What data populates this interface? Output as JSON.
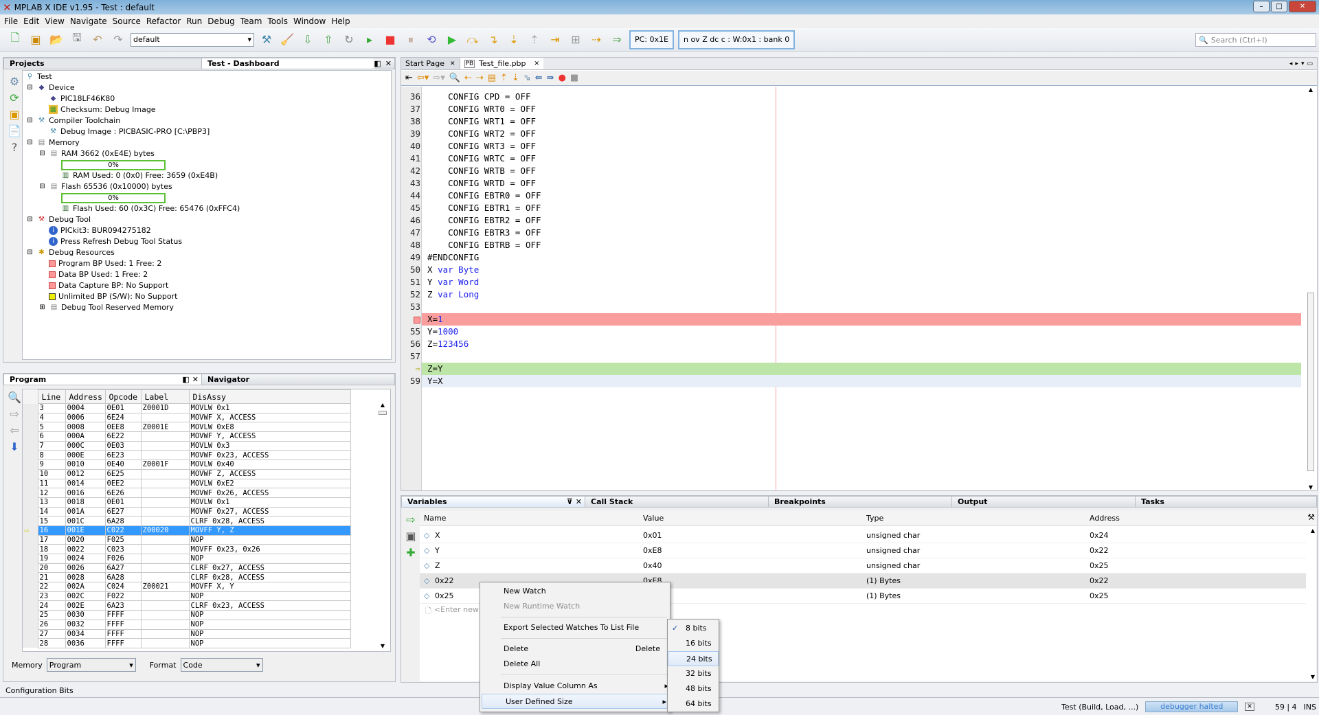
{
  "window": {
    "title": "MPLAB X IDE v1.95 - Test : default"
  },
  "menu": [
    "File",
    "Edit",
    "View",
    "Navigate",
    "Source",
    "Refactor",
    "Run",
    "Debug",
    "Team",
    "Tools",
    "Window",
    "Help"
  ],
  "toolbar": {
    "config_select": "default",
    "pc": "PC: 0x1E",
    "status_reg": "n ov Z dc c  : W:0x1 : bank 0",
    "search_placeholder": "Search (Ctrl+I)"
  },
  "projects": {
    "tab_projects": "Projects",
    "tab_dashboard": "Test - Dashboard",
    "tree": {
      "root": "Test",
      "device": "Device",
      "device_name": "PIC18LF46K80",
      "checksum": "Checksum: Debug Image",
      "compiler": "Compiler Toolchain",
      "debug_image": "Debug Image : PICBASIC-PRO [C:\\PBP3]",
      "memory": "Memory",
      "ram": "RAM 3662 (0xE4E) bytes",
      "ram_pct": "0%",
      "ram_used": "RAM Used: 0 (0x0) Free: 3659 (0xE4B)",
      "flash": "Flash 65536 (0x10000) bytes",
      "flash_pct": "0%",
      "flash_used": "Flash Used: 60 (0x3C) Free: 65476 (0xFFC4)",
      "debug_tool": "Debug Tool",
      "pickit": "PICkit3: BUR094275182",
      "refresh": "Press Refresh Debug Tool Status",
      "debug_resources": "Debug Resources",
      "prog_bp": "Program BP Used: 1  Free: 2",
      "data_bp": "Data BP Used: 1  Free: 2",
      "data_capture": "Data Capture BP: No Support",
      "unlimited_bp": "Unlimited BP (S/W): No Support",
      "reserved": "Debug Tool Reserved Memory"
    },
    "ram_fraction": 0,
    "flash_fraction": 0
  },
  "program": {
    "tab_program": "Program",
    "tab_navigator": "Navigator",
    "columns": [
      "Line",
      "Address",
      "Opcode",
      "Label",
      "DisAssy"
    ],
    "rows": [
      [
        "3",
        "0004",
        "0E01",
        "Z0001D",
        "MOVLW 0x1"
      ],
      [
        "4",
        "0006",
        "6E24",
        "",
        "MOVWF X, ACCESS"
      ],
      [
        "5",
        "0008",
        "0EE8",
        "Z0001E",
        "MOVLW 0xE8"
      ],
      [
        "6",
        "000A",
        "6E22",
        "",
        "MOVWF Y, ACCESS"
      ],
      [
        "7",
        "000C",
        "0E03",
        "",
        "MOVLW 0x3"
      ],
      [
        "8",
        "000E",
        "6E23",
        "",
        "MOVWF 0x23, ACCESS"
      ],
      [
        "9",
        "0010",
        "0E40",
        "Z0001F",
        "MOVLW 0x40"
      ],
      [
        "10",
        "0012",
        "6E25",
        "",
        "MOVWF Z, ACCESS"
      ],
      [
        "11",
        "0014",
        "0EE2",
        "",
        "MOVLW 0xE2"
      ],
      [
        "12",
        "0016",
        "6E26",
        "",
        "MOVWF 0x26, ACCESS"
      ],
      [
        "13",
        "0018",
        "0E01",
        "",
        "MOVLW 0x1"
      ],
      [
        "14",
        "001A",
        "6E27",
        "",
        "MOVWF 0x27, ACCESS"
      ],
      [
        "15",
        "001C",
        "6A28",
        "",
        "CLRF 0x28, ACCESS"
      ],
      [
        "16",
        "001E",
        "C022",
        "Z00020",
        "MOVFF Y, Z"
      ],
      [
        "17",
        "0020",
        "F025",
        "",
        "NOP"
      ],
      [
        "18",
        "0022",
        "C023",
        "",
        "MOVFF 0x23, 0x26"
      ],
      [
        "19",
        "0024",
        "F026",
        "",
        "NOP"
      ],
      [
        "20",
        "0026",
        "6A27",
        "",
        "CLRF 0x27, ACCESS"
      ],
      [
        "21",
        "0028",
        "6A28",
        "",
        "CLRF 0x28, ACCESS"
      ],
      [
        "22",
        "002A",
        "C024",
        "Z00021",
        "MOVFF X, Y"
      ],
      [
        "23",
        "002C",
        "F022",
        "",
        "NOP"
      ],
      [
        "24",
        "002E",
        "6A23",
        "",
        "CLRF 0x23, ACCESS"
      ],
      [
        "25",
        "0030",
        "FFFF",
        "",
        "NOP"
      ],
      [
        "26",
        "0032",
        "FFFF",
        "",
        "NOP"
      ],
      [
        "27",
        "0034",
        "FFFF",
        "",
        "NOP"
      ],
      [
        "28",
        "0036",
        "FFFF",
        "",
        "NOP"
      ]
    ],
    "current_line": "16",
    "memory_label": "Memory",
    "memory_value": "Program",
    "format_label": "Format",
    "format_value": "Code"
  },
  "config_bits": "Configuration Bits",
  "editor": {
    "tabs": [
      "Start Page",
      "Test_file.pbp"
    ],
    "lines": [
      {
        "n": "36",
        "parts": [
          [
            "    CONFIG CPD = OFF",
            ""
          ]
        ]
      },
      {
        "n": "37",
        "parts": [
          [
            "    CONFIG WRT0 = OFF",
            ""
          ]
        ]
      },
      {
        "n": "38",
        "parts": [
          [
            "    CONFIG WRT1 = OFF",
            ""
          ]
        ]
      },
      {
        "n": "39",
        "parts": [
          [
            "    CONFIG WRT2 = OFF",
            ""
          ]
        ]
      },
      {
        "n": "40",
        "parts": [
          [
            "    CONFIG WRT3 = OFF",
            ""
          ]
        ]
      },
      {
        "n": "41",
        "parts": [
          [
            "    CONFIG WRTC = OFF",
            ""
          ]
        ]
      },
      {
        "n": "42",
        "parts": [
          [
            "    CONFIG WRTB = OFF",
            ""
          ]
        ]
      },
      {
        "n": "43",
        "parts": [
          [
            "    CONFIG WRTD = OFF",
            ""
          ]
        ]
      },
      {
        "n": "44",
        "parts": [
          [
            "    CONFIG EBTR0 = OFF",
            ""
          ]
        ]
      },
      {
        "n": "45",
        "parts": [
          [
            "    CONFIG EBTR1 = OFF",
            ""
          ]
        ]
      },
      {
        "n": "46",
        "parts": [
          [
            "    CONFIG EBTR2 = OFF",
            ""
          ]
        ]
      },
      {
        "n": "47",
        "parts": [
          [
            "    CONFIG EBTR3 = OFF",
            ""
          ]
        ]
      },
      {
        "n": "48",
        "parts": [
          [
            "    CONFIG EBTRB = OFF",
            ""
          ]
        ]
      },
      {
        "n": "49",
        "parts": [
          [
            "#ENDCONFIG",
            ""
          ]
        ]
      },
      {
        "n": "50",
        "parts": [
          [
            "X ",
            ""
          ],
          [
            "var Byte",
            "kw"
          ]
        ]
      },
      {
        "n": "51",
        "parts": [
          [
            "Y ",
            ""
          ],
          [
            "var Word",
            "kw"
          ]
        ]
      },
      {
        "n": "52",
        "parts": [
          [
            "Z ",
            ""
          ],
          [
            "var Long",
            "kw"
          ]
        ]
      },
      {
        "n": "53",
        "parts": []
      },
      {
        "n": "",
        "marker": "breakpoint",
        "parts": [
          [
            "X=",
            ""
          ],
          [
            "1",
            "num"
          ]
        ]
      },
      {
        "n": "55",
        "parts": [
          [
            "Y=",
            ""
          ],
          [
            "1000",
            "num"
          ]
        ]
      },
      {
        "n": "56",
        "parts": [
          [
            "Z=",
            ""
          ],
          [
            "123456",
            "num"
          ]
        ]
      },
      {
        "n": "57",
        "parts": []
      },
      {
        "n": "",
        "marker": "pc",
        "parts": [
          [
            "Z=Y",
            ""
          ]
        ]
      },
      {
        "n": "59",
        "marker": "cursor",
        "parts": [
          [
            "Y=X",
            ""
          ]
        ]
      }
    ]
  },
  "bottom": {
    "tabs": [
      "Variables",
      "Call Stack",
      "Breakpoints",
      "Output",
      "Tasks"
    ],
    "columns": [
      "Name",
      "Value",
      "Type",
      "Address"
    ],
    "rows": [
      [
        "X",
        "0x01",
        "unsigned char",
        "0x24"
      ],
      [
        "Y",
        "0xE8",
        "unsigned char",
        "0x22"
      ],
      [
        "Z",
        "0x40",
        "unsigned char",
        "0x25"
      ],
      [
        "0x22",
        "0xE8",
        "(1) Bytes",
        "0x22"
      ],
      [
        "0x25",
        "",
        "(1) Bytes",
        "0x25"
      ]
    ],
    "enter_new": "<Enter new"
  },
  "context_menu": {
    "new_watch": "New Watch",
    "new_runtime_watch": "New Runtime Watch",
    "export": "Export Selected Watches To List File",
    "delete": "Delete",
    "delete_shortcut": "Delete",
    "delete_all": "Delete All",
    "display_as": "Display Value Column As",
    "user_size": "User Defined Size"
  },
  "submenu": {
    "items": [
      "8 bits",
      "16 bits",
      "24 bits",
      "32 bits",
      "48 bits",
      "64 bits"
    ],
    "checked": "8 bits",
    "hovered": "24 bits"
  },
  "statusbar": {
    "task": "Test (Build, Load, ...)",
    "progress": "debugger halted",
    "position": "59 | 4",
    "mode": "INS"
  },
  "colors": {
    "breakpoint_line": "#f99d9d",
    "pc_line": "#bde5a8",
    "selection": "#3399ff",
    "progress_green": "#5ac134"
  }
}
